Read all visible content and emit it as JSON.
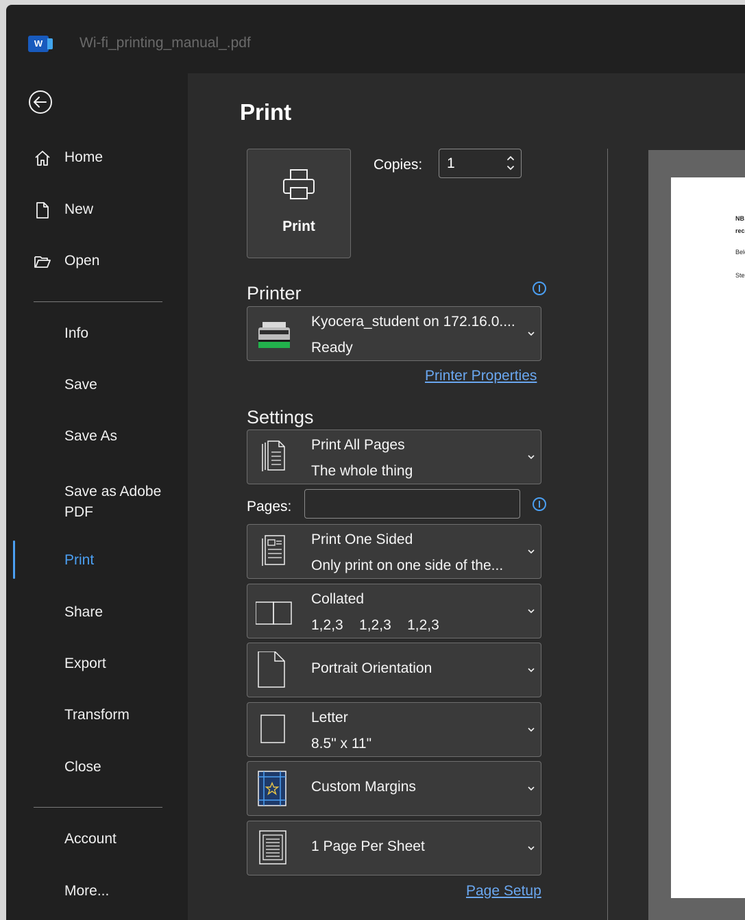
{
  "titlebar": {
    "app_icon_letter": "W",
    "doc_title": "Wi-fi_printing_manual_.pdf"
  },
  "sidebar": {
    "items": [
      {
        "label": "Home"
      },
      {
        "label": "New"
      },
      {
        "label": "Open"
      },
      {
        "label": "Info"
      },
      {
        "label": "Save"
      },
      {
        "label": "Save As"
      },
      {
        "label": "Save as Adobe PDF"
      },
      {
        "label": "Print"
      },
      {
        "label": "Share"
      },
      {
        "label": "Export"
      },
      {
        "label": "Transform"
      },
      {
        "label": "Close"
      },
      {
        "label": "Account"
      },
      {
        "label": "More..."
      }
    ],
    "active": "Print"
  },
  "main": {
    "title": "Print",
    "print_button_label": "Print",
    "copies": {
      "label": "Copies:",
      "value": "1"
    },
    "printer": {
      "section_title": "Printer",
      "name": "Kyocera_student on 172.16.0....",
      "status": "Ready",
      "properties_link": "Printer Properties"
    },
    "settings": {
      "section_title": "Settings",
      "print_range": {
        "title": "Print All Pages",
        "subtitle": "The whole thing"
      },
      "pages_label": "Pages:",
      "pages_value": "",
      "sides": {
        "title": "Print One Sided",
        "subtitle": "Only print on one side of the..."
      },
      "collation": {
        "title": "Collated",
        "subtitle": "1,2,3    1,2,3    1,2,3"
      },
      "orientation": {
        "title": "Portrait Orientation"
      },
      "paper": {
        "title": "Letter",
        "subtitle": "8.5\" x 11\""
      },
      "margins": {
        "title": "Custom Margins"
      },
      "per_sheet": {
        "title": "1 Page Per Sheet"
      },
      "page_setup_link": "Page Setup"
    }
  },
  "preview": {
    "lines": [
      "NB:",
      "rec",
      "Belo",
      "Step"
    ]
  },
  "colors": {
    "accent": "#4b9ff2",
    "link": "#6aa7f0",
    "window_bg": "#202020",
    "main_bg": "#2b2b2b",
    "control_bg": "#3a3a3a"
  }
}
